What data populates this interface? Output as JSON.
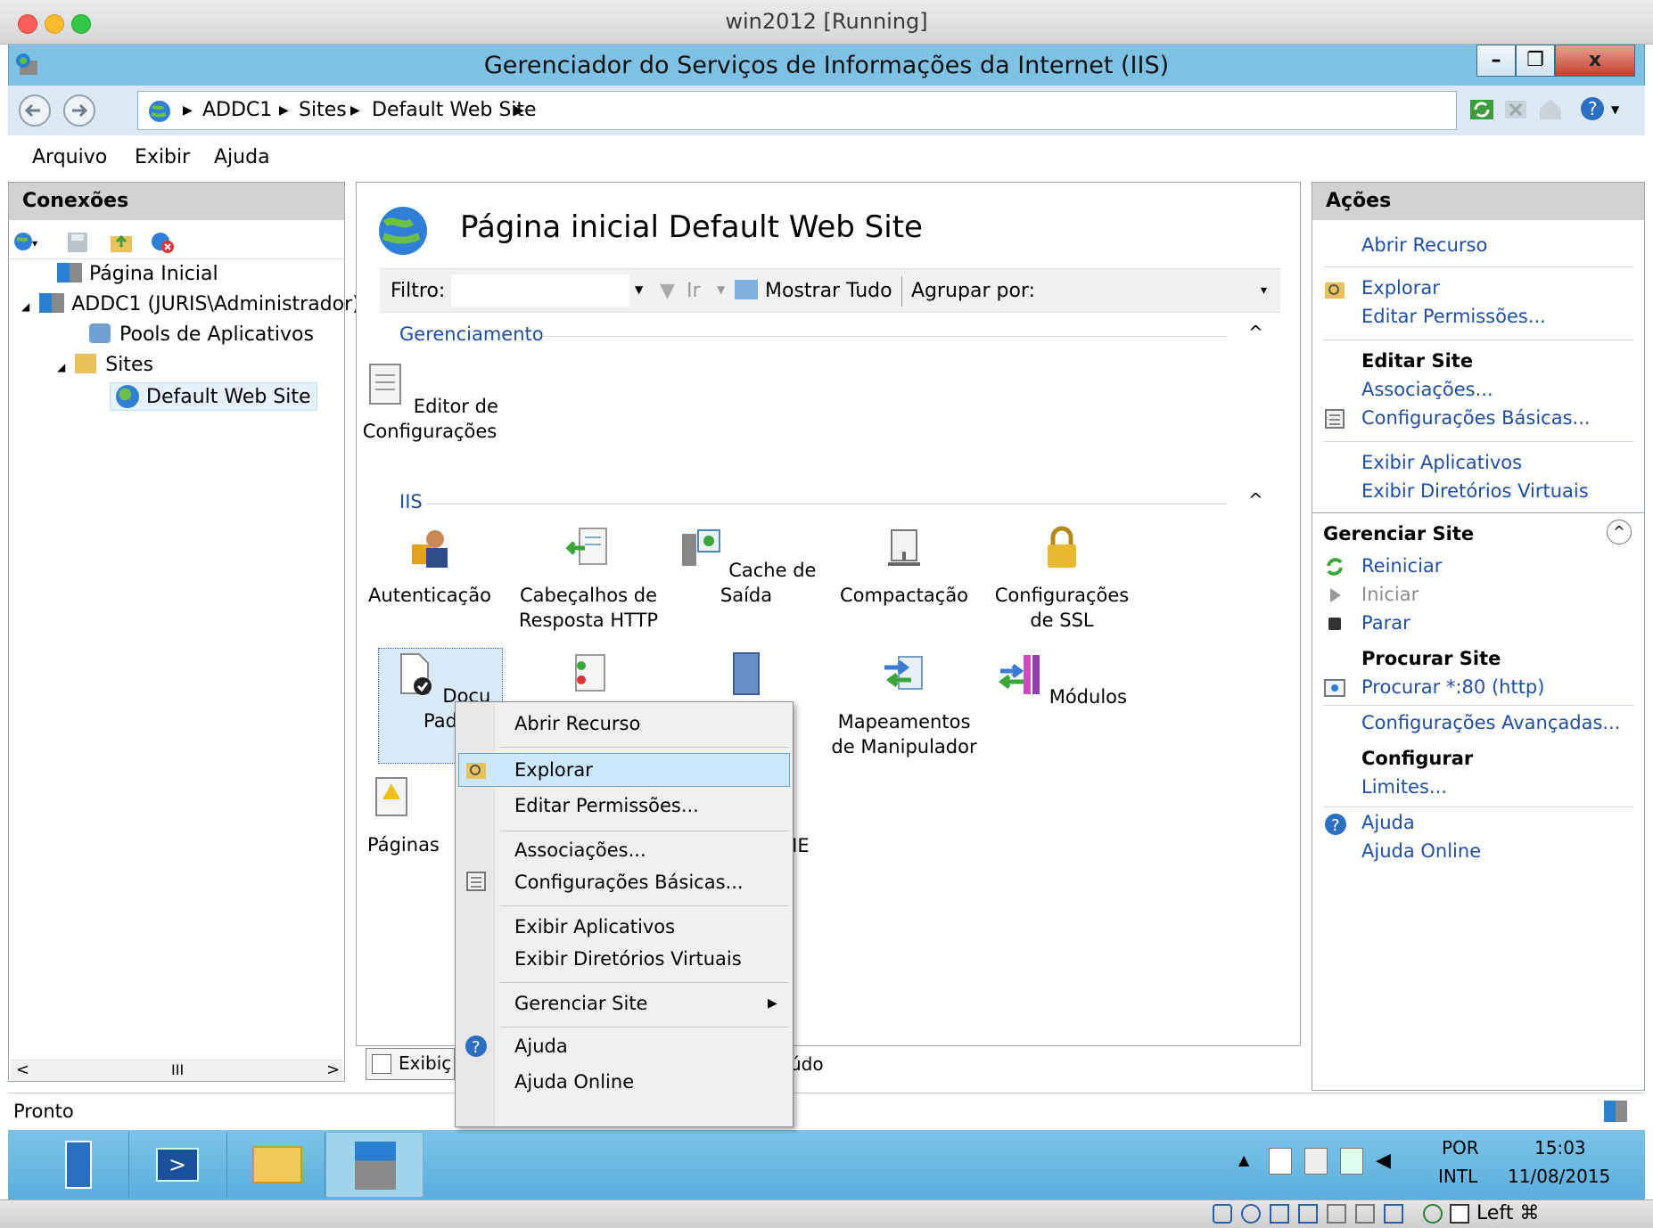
{
  "vm_title": "win2012 [Running]",
  "window": {
    "title": "Gerenciador do Serviços de Informações da Internet (IIS)",
    "minimize": "–",
    "restore": "❐",
    "close": "x"
  },
  "breadcrumb": [
    "ADDC1",
    "Sites",
    "Default Web Site"
  ],
  "menu": [
    "Arquivo",
    "Exibir",
    "Ajuda"
  ],
  "connections": {
    "title": "Conexões",
    "tree": [
      "Página Inicial",
      "ADDC1 (JURIS\\Administrador)",
      "Pools de Aplicativos",
      "Sites",
      "Default Web Site"
    ],
    "hscroll_grip": "III"
  },
  "center": {
    "title": "Página inicial Default Web Site",
    "filter_label": "Filtro:",
    "go_label": "Ir",
    "show_all": "Mostrar Tudo",
    "group_by": "Agrupar por:",
    "sections": [
      "Gerenciamento",
      "IIS"
    ],
    "features": [
      "Editor de Configurações",
      "Autenticação",
      "Cabeçalhos de Resposta HTTP",
      "Cache de Saída",
      "Compactação",
      "Configurações de SSL",
      "Docu",
      "Pad",
      "Mapeamentos de Manipulador",
      "Módulos",
      "Páginas",
      "MIME"
    ],
    "bottom_tab_left": "Exibiç",
    "bottom_tab_right": "údo"
  },
  "actions": {
    "title": "Ações",
    "items": [
      "Abrir Recurso",
      "Explorar",
      "Editar Permissões...",
      "Editar Site",
      "Associações...",
      "Configurações Básicas...",
      "Exibir Aplicativos",
      "Exibir Diretórios Virtuais",
      "Gerenciar Site",
      "Reiniciar",
      "Iniciar",
      "Parar",
      "Procurar Site",
      "Procurar *:80 (http)",
      "Configurações Avançadas...",
      "Configurar",
      "Limites...",
      "Ajuda",
      "Ajuda Online"
    ]
  },
  "context_menu": [
    "Abrir Recurso",
    "Explorar",
    "Editar Permissões...",
    "Associações...",
    "Configurações Básicas...",
    "Exibir Aplicativos",
    "Exibir Diretórios Virtuais",
    "Gerenciar Site",
    "Ajuda",
    "Ajuda Online"
  ],
  "status": "Pronto",
  "tray": {
    "lang1": "POR",
    "lang2": "INTL",
    "time": "15:03",
    "date": "11/08/2015"
  },
  "host_key": "Left ⌘",
  "colors": {
    "accent": "#7ec1e4",
    "link": "#1f4ea0",
    "highlight": "#cce8ff"
  }
}
